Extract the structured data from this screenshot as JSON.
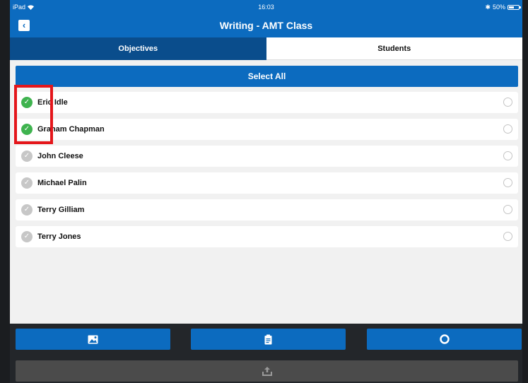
{
  "statusbar": {
    "device": "iPad",
    "time": "16:03",
    "battery": "50%"
  },
  "navbar": {
    "title": "Writing - AMT Class"
  },
  "tabs": [
    {
      "label": "Objectives",
      "active": false
    },
    {
      "label": "Students",
      "active": true
    }
  ],
  "select_all_label": "Select All",
  "students": [
    {
      "name": "Eric Idle",
      "checked": true
    },
    {
      "name": "Graham Chapman",
      "checked": true
    },
    {
      "name": "John Cleese",
      "checked": false
    },
    {
      "name": "Michael Palin",
      "checked": false
    },
    {
      "name": "Terry Gilliam",
      "checked": false
    },
    {
      "name": "Terry Jones",
      "checked": false
    }
  ],
  "toolbar": {
    "icons": [
      "image-icon",
      "clipboard-icon",
      "circle-icon",
      "upload-icon"
    ]
  },
  "colors": {
    "primary": "#0c6bbf",
    "tab_dark": "#0a4d8c",
    "check_green": "#3fb34f",
    "highlight_red": "#e4161b"
  }
}
